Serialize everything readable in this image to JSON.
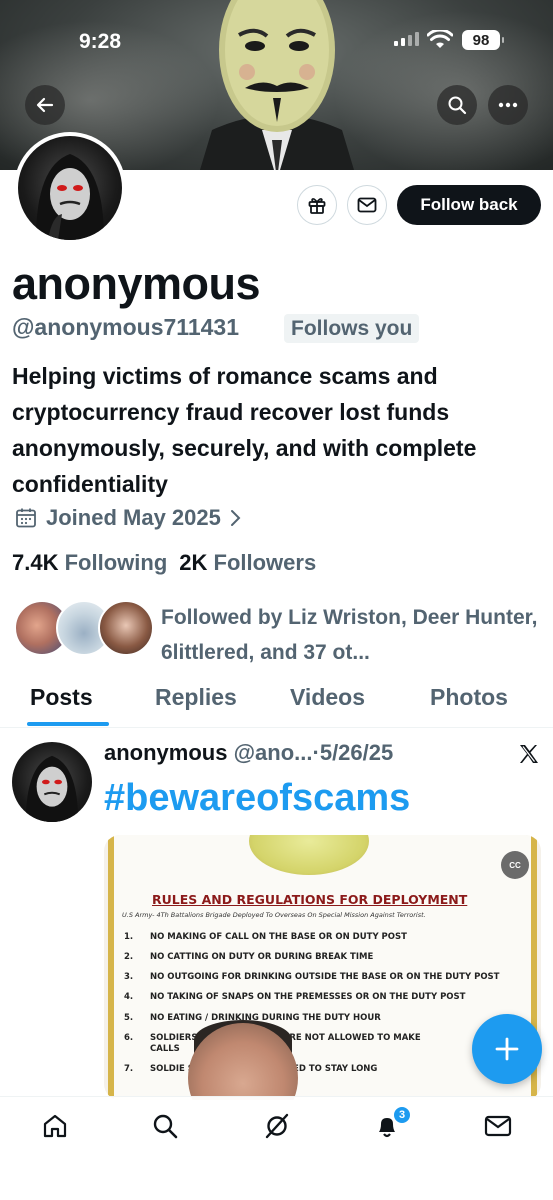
{
  "status_bar": {
    "time": "9:28",
    "battery": "98"
  },
  "profile": {
    "name": "anonymous",
    "handle": "@anonymous711431",
    "follows_you": "Follows you",
    "bio": "Helping victims of romance scams and cryptocurrency fraud recover lost funds anonymously, securely, and with complete confidentiality",
    "joined": "Joined May 2025",
    "following_count": "7.4K",
    "following_label": "Following",
    "followers_count": "2K",
    "followers_label": "Followers",
    "followed_by": "Followed by Liz Wriston, Deer Hunter, 6littlered, and 37 ot...",
    "follow_button": "Follow back"
  },
  "tabs": [
    {
      "label": "Posts",
      "active": true
    },
    {
      "label": "Replies",
      "active": false
    },
    {
      "label": "Videos",
      "active": false
    },
    {
      "label": "Photos",
      "active": false
    }
  ],
  "post": {
    "author_name": "anonymous",
    "author_handle": "@ano...",
    "separator": "·",
    "date": "5/26/25",
    "text": "#bewareofscams",
    "media": {
      "title": "RULES AND REGULATIONS FOR DEPLOYMENT",
      "subtitle": "U.S Army- 4Th Battalions Brigade Deployed To Overseas On Special Mission Against Terrorist.",
      "rules": [
        {
          "num": "1.",
          "text": "NO MAKING OF CALL ON THE BASE OR ON DUTY POST"
        },
        {
          "num": "2.",
          "text": "NO CATTING ON DUTY OR DURING BREAK TIME"
        },
        {
          "num": "3.",
          "text": "NO OUTGOING FOR DRINKING OUTSIDE THE BASE OR ON THE DUTY POST"
        },
        {
          "num": "4.",
          "text": "NO TAKING OF SNAPS ON THE PREMESSES OR ON THE DUTY POST"
        },
        {
          "num": "5.",
          "text": "NO EATING / DRINKING DURING THE DUTY HOUR"
        },
        {
          "num": "6.",
          "text": "SOLDIERS O        MISSION HERE ARE NOT ALLOWED TO MAKE"
        },
        {
          "num": "",
          "text": "CALLS"
        },
        {
          "num": "7.",
          "text": "SOLDIE            SION ARE NOT ALLOWED TO STAY LONG"
        }
      ],
      "cc_label": "CC"
    }
  },
  "bottom_nav": {
    "notifications_badge": "3"
  },
  "colors": {
    "accent": "#1d9bf0",
    "text": "#0f1419",
    "secondary": "#536471"
  }
}
